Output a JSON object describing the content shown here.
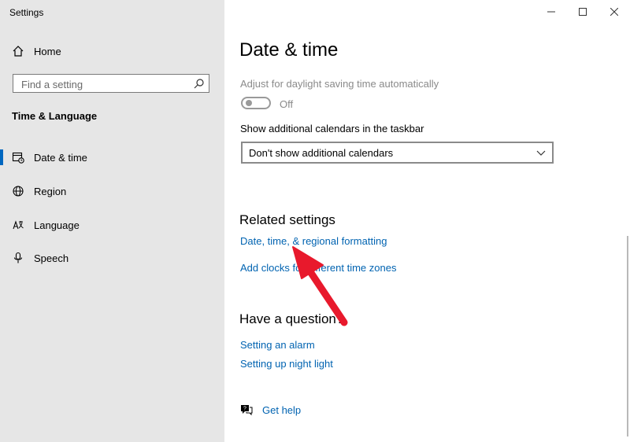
{
  "window": {
    "title": "Settings"
  },
  "sidebar": {
    "home_label": "Home",
    "search_placeholder": "Find a setting",
    "section_title": "Time & Language",
    "items": [
      {
        "label": "Date & time",
        "icon": "calendar-clock-icon",
        "selected": true
      },
      {
        "label": "Region",
        "icon": "globe-icon"
      },
      {
        "label": "Language",
        "icon": "language-icon"
      },
      {
        "label": "Speech",
        "icon": "microphone-icon"
      }
    ]
  },
  "main": {
    "title": "Date & time",
    "dst_label": "Adjust for daylight saving time automatically",
    "dst_toggle_state": "Off",
    "calendars_label": "Show additional calendars in the taskbar",
    "calendars_value": "Don't show additional calendars",
    "related_title": "Related settings",
    "related_links": [
      "Date, time, & regional formatting",
      "Add clocks for different time zones"
    ],
    "question_title": "Have a question?",
    "question_links": [
      "Setting an alarm",
      "Setting up night light"
    ],
    "help_label": "Get help"
  },
  "colors": {
    "accent": "#0067c0",
    "link": "#0063b1",
    "sidebar_bg": "#e6e6e6",
    "annotation_arrow": "#e8192c"
  }
}
